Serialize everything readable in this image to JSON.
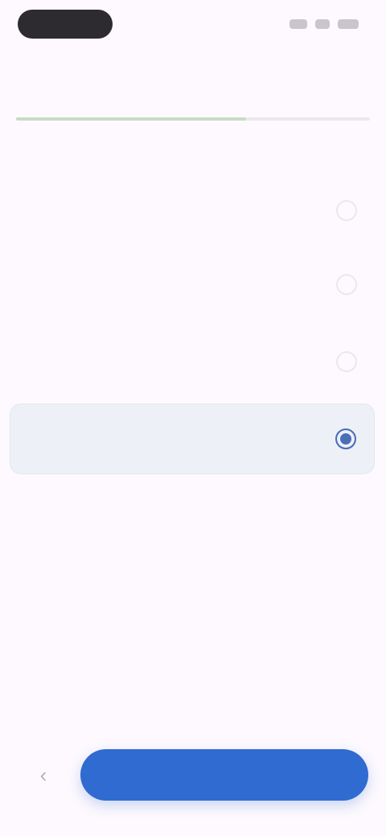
{
  "header": {
    "title": ""
  },
  "progress": {
    "fraction": 0.65
  },
  "question": {
    "text": ""
  },
  "options": [
    {
      "label": "",
      "selected": false
    },
    {
      "label": "",
      "selected": false
    },
    {
      "label": "",
      "selected": false
    },
    {
      "label": "",
      "selected": true
    }
  ],
  "footer": {
    "back_icon": "chevron-left-icon",
    "back_glyph": "‹",
    "primary_label": ""
  },
  "colors": {
    "background": "#fdf9fe",
    "primary": "#2f6bd0",
    "selected_fill": "#eef0f8",
    "radio_selected": "#4a6fb8",
    "progress_fill": "#c8dcc4"
  }
}
